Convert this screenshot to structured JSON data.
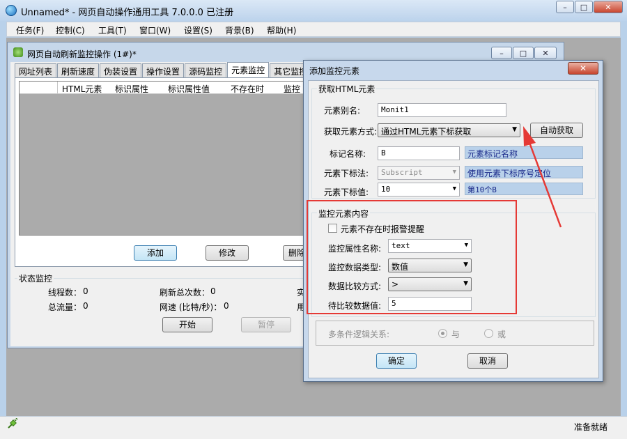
{
  "app": {
    "title": "Unnamed* - 网页自动操作通用工具 7.0.0.0 已注册"
  },
  "window_controls": {
    "minimize": "–",
    "maximize": "□",
    "close": "✕"
  },
  "menu": [
    "任务(F)",
    "控制(C)",
    "工具(T)",
    "窗口(W)",
    "设置(S)",
    "背景(B)",
    "帮助(H)"
  ],
  "child": {
    "title": "网页自动刷新监控操作 (1#)*",
    "tabs": [
      "网址列表",
      "刷新速度",
      "伪装设置",
      "操作设置",
      "源码监控",
      "元素监控",
      "其它监控"
    ],
    "active_tab": "元素监控",
    "columns": [
      "HTML元素",
      "标识属性",
      "标识属性值",
      "不存在时",
      "监控"
    ],
    "buttons": {
      "add": "添加",
      "edit": "修改",
      "delete": "删除"
    },
    "status": {
      "label": "状态监控",
      "threads_label": "线程数：",
      "threads": "0",
      "refresh_label": "刷新总次数：",
      "refresh": "0",
      "real": "实",
      "traffic_label": "总流量：",
      "traffic": "0",
      "speed_label": "网速 (比特/秒)：",
      "speed": "0",
      "used": "用"
    },
    "start": "开始",
    "pause": "暂停"
  },
  "dialog": {
    "title": "添加监控元素",
    "close": "✕",
    "get_group": "获取HTML元素",
    "alias_label": "元素别名:",
    "alias": "Monit1",
    "method_label": "获取元素方式:",
    "method": "通过HTML元素下标获取",
    "auto_btn": "自动获取",
    "tag_label": "标记名称:",
    "tag": "B",
    "tag_hint": "元素标记名称",
    "index_method_label": "元素下标法:",
    "index_method": "Subscript",
    "index_method_hint": "使用元素下标序号定位",
    "index_label": "元素下标值:",
    "index": "10",
    "index_hint": "第10个B",
    "monitor_group": "监控元素内容",
    "alarm_checkbox": "元素不存在时报警提醒",
    "attr_label": "监控属性名称:",
    "attr": "text",
    "type_label": "监控数据类型:",
    "type": "数值",
    "compare_label": "数据比较方式:",
    "compare": ">",
    "value_label": "待比较数据值:",
    "value": "5",
    "logic_label": "多条件逻辑关系:",
    "logic_and": "与",
    "logic_or": "或",
    "ok": "确定",
    "cancel": "取消"
  },
  "statusbar": {
    "text": "准备就绪"
  },
  "colors": {
    "annotation_red": "#e53935",
    "hint_bg": "#b9d1ea"
  },
  "icons": {
    "app": "globe-icon",
    "child": "green-page-icon",
    "status": "plug-icon"
  }
}
